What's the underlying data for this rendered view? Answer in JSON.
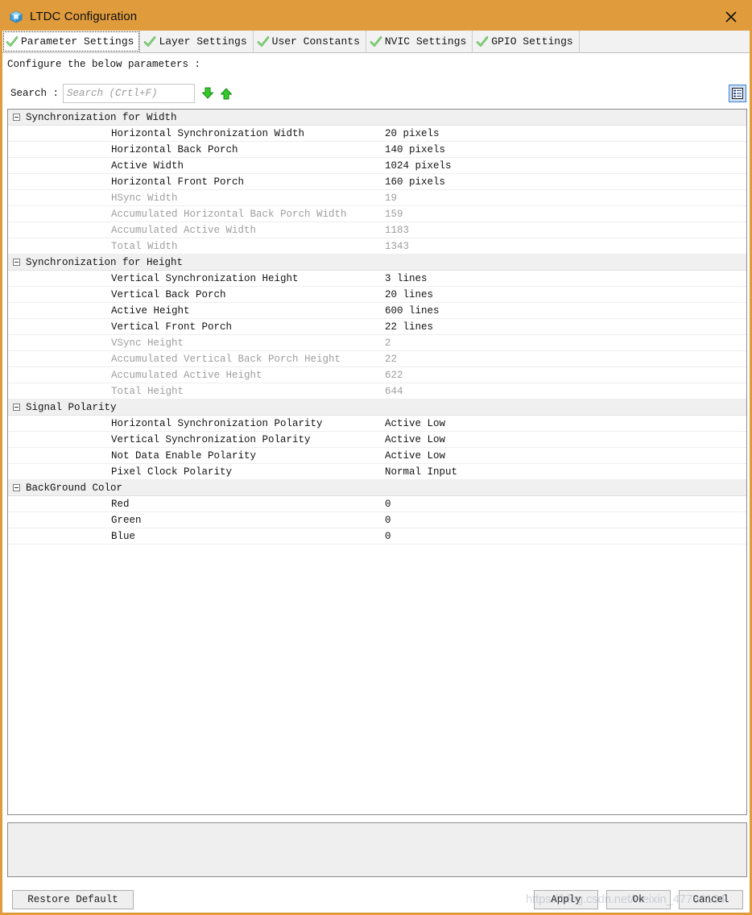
{
  "window": {
    "title": "LTDC Configuration",
    "icon": "cube-icon",
    "close_label": "✕",
    "accent_color": "#e09b3d"
  },
  "tabs": [
    {
      "label": "Parameter Settings",
      "icon": "green-check-icon",
      "active": true
    },
    {
      "label": "Layer Settings",
      "icon": "green-check-icon",
      "active": false
    },
    {
      "label": "User Constants",
      "icon": "green-check-icon",
      "active": false
    },
    {
      "label": "NVIC Settings",
      "icon": "green-check-icon",
      "active": false
    },
    {
      "label": "GPIO Settings",
      "icon": "green-check-icon",
      "active": false
    }
  ],
  "instruction": "Configure the below parameters :",
  "search": {
    "label": "Search :",
    "value": "",
    "placeholder": "Search (Crtl+F)",
    "next_icon": "arrow-down-icon",
    "prev_icon": "arrow-up-icon",
    "viewmode_icon": "list-view-icon"
  },
  "tree": [
    {
      "group": "Synchronization for Width",
      "expanded": true,
      "rows": [
        {
          "name": "Horizontal Synchronization Width",
          "value": "20 pixels",
          "readonly": false
        },
        {
          "name": "Horizontal Back Porch",
          "value": "140 pixels",
          "readonly": false
        },
        {
          "name": "Active Width",
          "value": "1024 pixels",
          "readonly": false
        },
        {
          "name": "Horizontal Front Porch",
          "value": "160 pixels",
          "readonly": false
        },
        {
          "name": "HSync Width",
          "value": "19",
          "readonly": true
        },
        {
          "name": "Accumulated Horizontal Back Porch Width",
          "value": "159",
          "readonly": true
        },
        {
          "name": "Accumulated Active Width",
          "value": "1183",
          "readonly": true
        },
        {
          "name": "Total Width",
          "value": "1343",
          "readonly": true
        }
      ]
    },
    {
      "group": "Synchronization for Height",
      "expanded": true,
      "rows": [
        {
          "name": "Vertical Synchronization Height",
          "value": "3 lines",
          "readonly": false
        },
        {
          "name": "Vertical Back Porch",
          "value": "20 lines",
          "readonly": false
        },
        {
          "name": "Active Height",
          "value": "600 lines",
          "readonly": false
        },
        {
          "name": "Vertical Front Porch",
          "value": "22 lines",
          "readonly": false
        },
        {
          "name": "VSync Height",
          "value": "2",
          "readonly": true
        },
        {
          "name": "Accumulated Vertical Back Porch Height",
          "value": "22",
          "readonly": true
        },
        {
          "name": "Accumulated Active Height",
          "value": "622",
          "readonly": true
        },
        {
          "name": "Total Height",
          "value": "644",
          "readonly": true
        }
      ]
    },
    {
      "group": "Signal Polarity",
      "expanded": true,
      "rows": [
        {
          "name": "Horizontal Synchronization Polarity",
          "value": "Active Low",
          "readonly": false
        },
        {
          "name": "Vertical Synchronization Polarity",
          "value": "Active Low",
          "readonly": false
        },
        {
          "name": "Not Data Enable Polarity",
          "value": "Active Low",
          "readonly": false
        },
        {
          "name": "Pixel Clock Polarity",
          "value": "Normal Input",
          "readonly": false
        }
      ]
    },
    {
      "group": "BackGround Color",
      "expanded": true,
      "rows": [
        {
          "name": "Red",
          "value": "0",
          "readonly": false
        },
        {
          "name": "Green",
          "value": "0",
          "readonly": false
        },
        {
          "name": "Blue",
          "value": "0",
          "readonly": false
        }
      ]
    }
  ],
  "info_panel": {
    "text": ""
  },
  "buttons": {
    "restore": "Restore Default",
    "apply": "Apply",
    "ok": "Ok",
    "cancel": "Cancel"
  },
  "watermark": "https://blog.csdn.net/weixin_47789134"
}
